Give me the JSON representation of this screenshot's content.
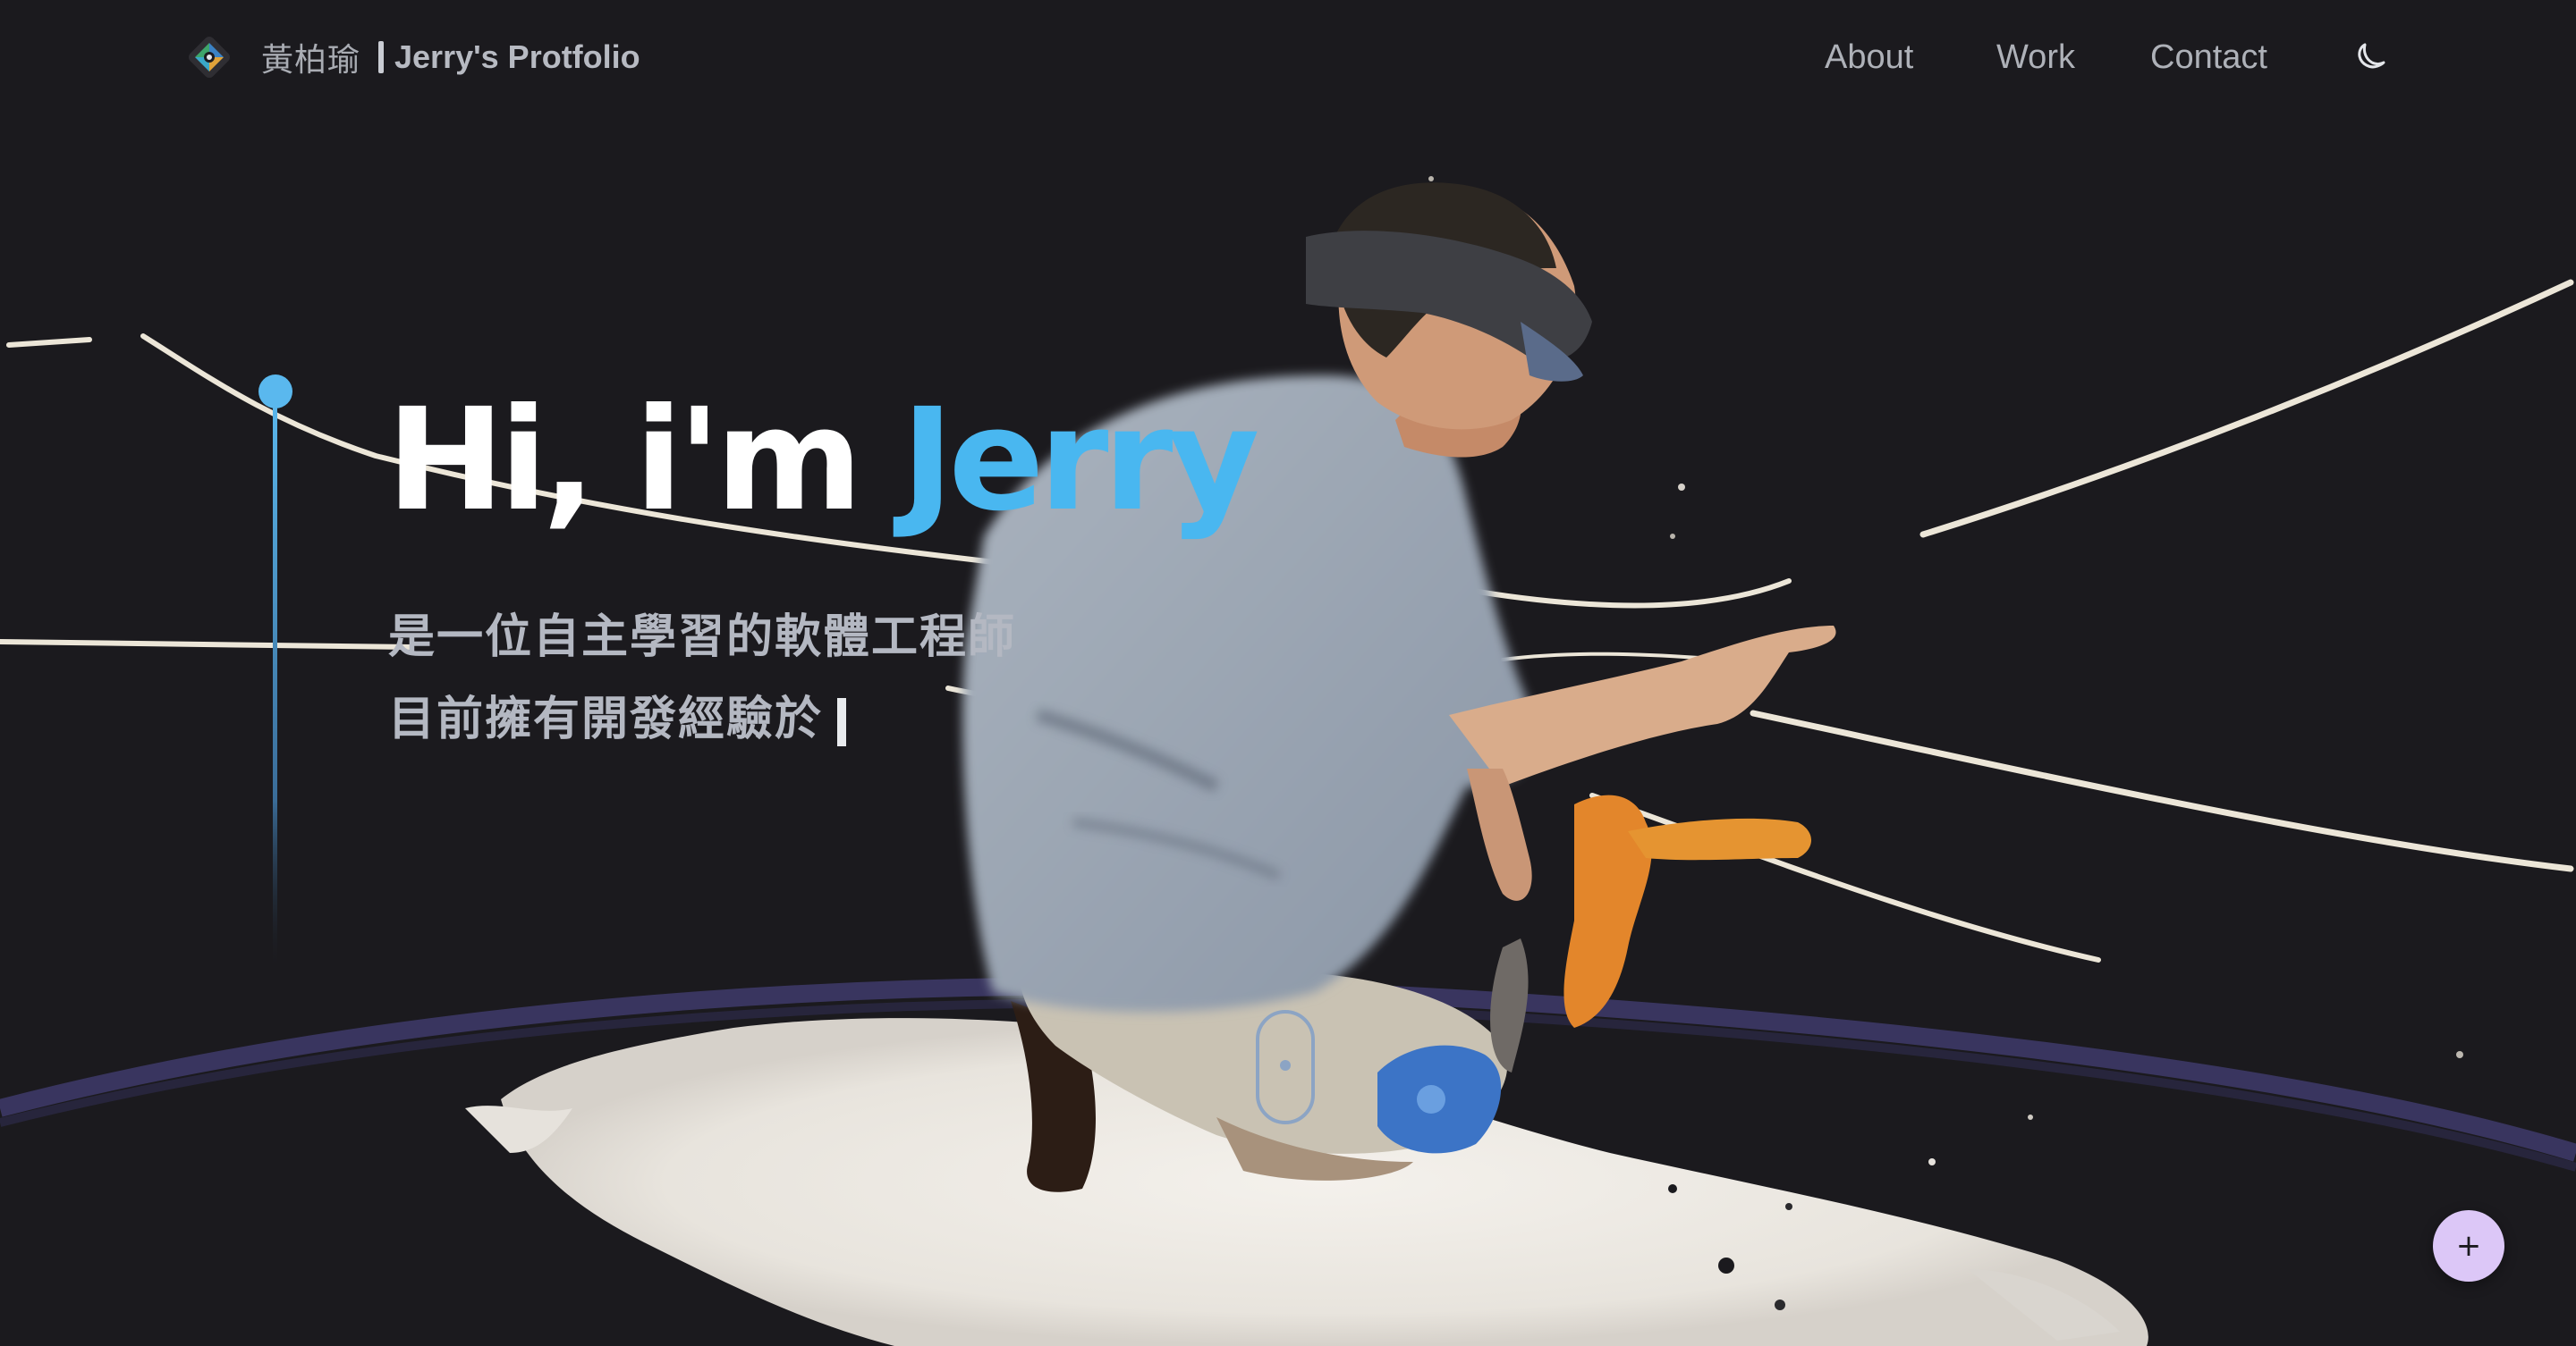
{
  "header": {
    "brand_name": "黃柏瑜",
    "brand_title": "Jerry's Protfolio",
    "nav": [
      {
        "label": "About"
      },
      {
        "label": "Work"
      },
      {
        "label": "Contact"
      }
    ],
    "theme_toggle_icon": "moon-icon",
    "logo_icon": "diamond-logo-icon"
  },
  "hero": {
    "greeting": "Hi, i'm ",
    "name": "Jerry",
    "line1": "是一位自主學習的軟體工程師",
    "line2": "目前擁有開發經驗於"
  },
  "controls": {
    "scroll_icon": "mouse-scroll-icon",
    "fab_label": "+"
  },
  "colors": {
    "background": "#1b1a1e",
    "accent": "#49b7f0",
    "fab": "#dcc7f7",
    "text_muted": "#b4b8c2"
  }
}
